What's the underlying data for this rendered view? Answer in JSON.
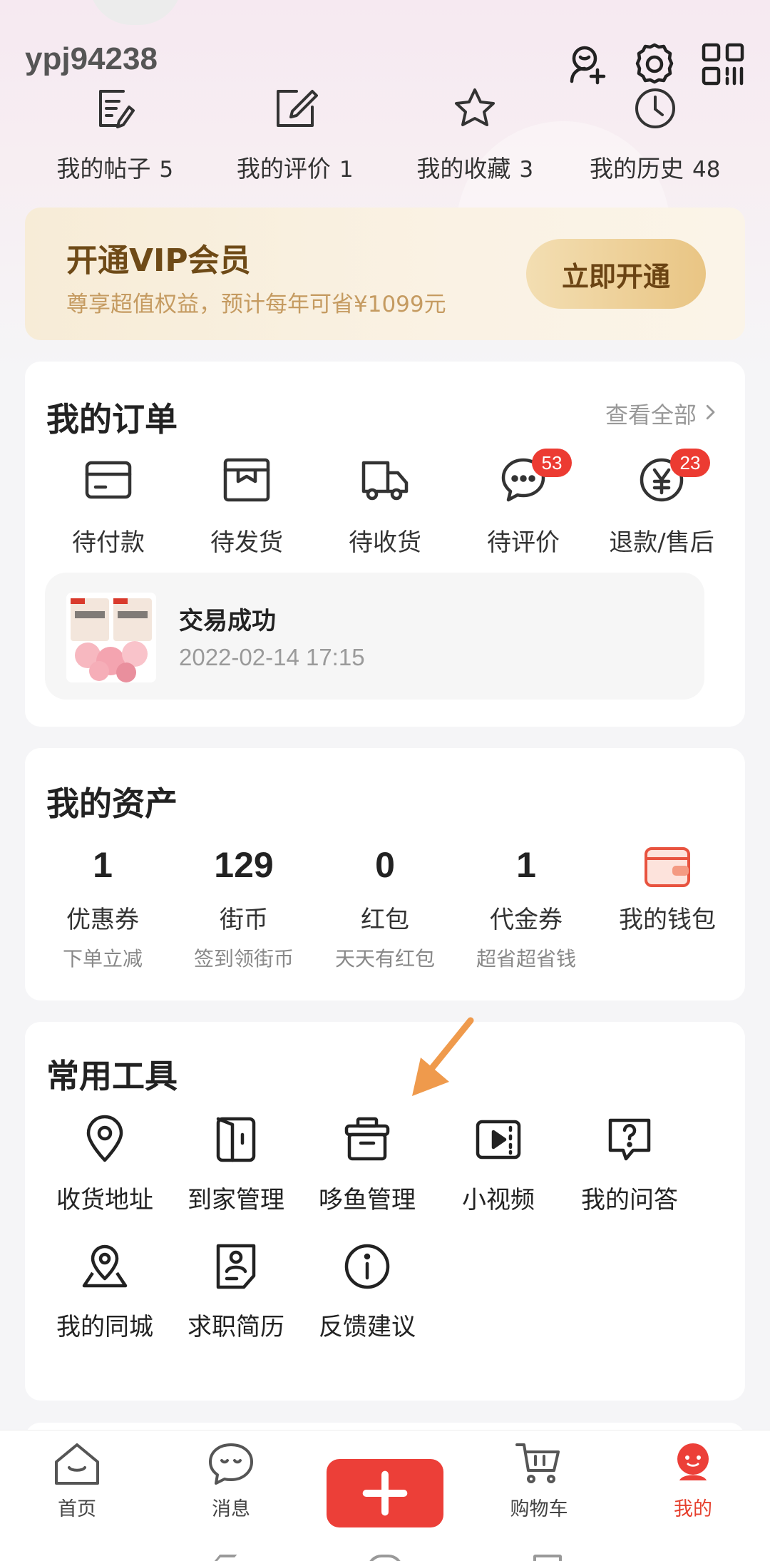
{
  "profile": {
    "username": "ypj94238",
    "header_icons": [
      "add-friend-icon",
      "settings-icon",
      "qr-code-icon"
    ]
  },
  "stats": [
    {
      "label": "我的帖子",
      "count": "5",
      "icon": "posts-icon"
    },
    {
      "label": "我的评价",
      "count": "1",
      "icon": "review-edit-icon"
    },
    {
      "label": "我的收藏",
      "count": "3",
      "icon": "star-icon"
    },
    {
      "label": "我的历史",
      "count": "48",
      "icon": "clock-icon"
    }
  ],
  "vip": {
    "title": "开通VIP会员",
    "subtitle": "尊享超值权益，预计每年可省¥1099元",
    "button": "立即开通"
  },
  "orders": {
    "title": "我的订单",
    "view_all": "查看全部",
    "items": [
      {
        "label": "待付款",
        "icon": "card-icon",
        "badge": ""
      },
      {
        "label": "待发货",
        "icon": "package-icon",
        "badge": ""
      },
      {
        "label": "待收货",
        "icon": "truck-icon",
        "badge": ""
      },
      {
        "label": "待评价",
        "icon": "chat-bubble-icon",
        "badge": "53"
      },
      {
        "label": "退款/售后",
        "icon": "yen-icon",
        "badge": "23"
      }
    ],
    "latest": {
      "status": "交易成功",
      "time": "2022-02-14 17:15",
      "thumb_text": "冻干草莓"
    }
  },
  "assets": {
    "title": "我的资产",
    "items": [
      {
        "value": "1",
        "name": "优惠券",
        "desc": "下单立减"
      },
      {
        "value": "129",
        "name": "街币",
        "desc": "签到领街币"
      },
      {
        "value": "0",
        "name": "红包",
        "desc": "天天有红包"
      },
      {
        "value": "1",
        "name": "代金券",
        "desc": "超省超省钱"
      }
    ],
    "wallet": {
      "name": "我的钱包",
      "icon": "wallet-icon"
    }
  },
  "tools": {
    "title": "常用工具",
    "row1": [
      {
        "label": "收货地址",
        "icon": "location-pin-icon"
      },
      {
        "label": "到家管理",
        "icon": "door-icon"
      },
      {
        "label": "哆鱼管理",
        "icon": "toolbox-icon"
      },
      {
        "label": "小视频",
        "icon": "video-icon"
      },
      {
        "label": "我的问答",
        "icon": "question-icon"
      }
    ],
    "row2": [
      {
        "label": "我的同城",
        "icon": "map-pin-icon"
      },
      {
        "label": "求职简历",
        "icon": "resume-icon"
      },
      {
        "label": "反馈建议",
        "icon": "info-icon"
      }
    ]
  },
  "tabbar": [
    {
      "label": "首页",
      "icon": "home-icon"
    },
    {
      "label": "消息",
      "icon": "message-icon"
    },
    {
      "label": "",
      "icon": "plus-icon"
    },
    {
      "label": "购物车",
      "icon": "cart-icon"
    },
    {
      "label": "我的",
      "icon": "profile-mascot-icon",
      "active": true
    }
  ],
  "colors": {
    "accent": "#ec3f38",
    "vip_text": "#6e4a17",
    "vip_sub": "#c59b61",
    "badge": "#ec3b32",
    "annotation_arrow": "#ef9a4c"
  }
}
